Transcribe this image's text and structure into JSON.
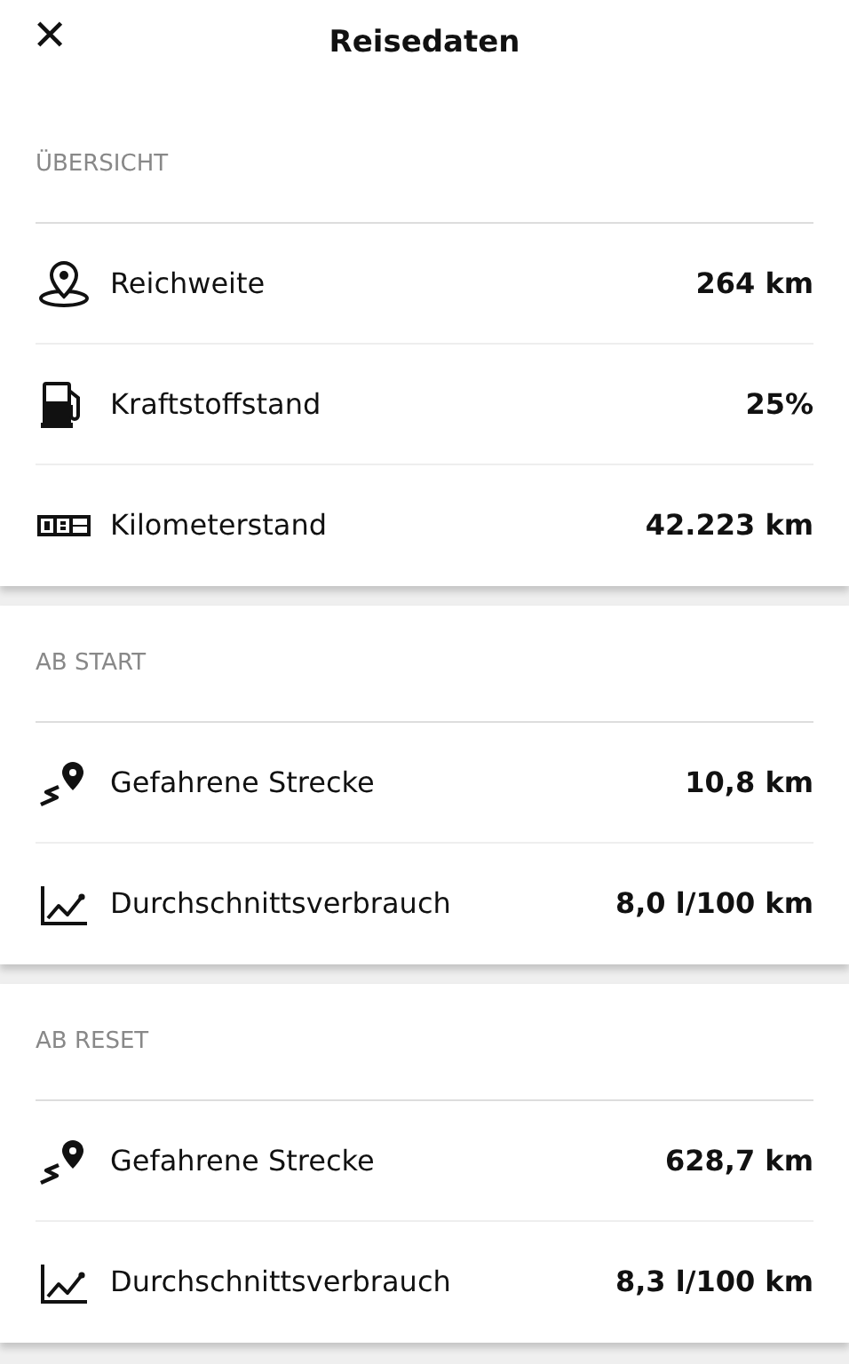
{
  "header": {
    "close": "✕",
    "title": "Reisedaten"
  },
  "sections": [
    {
      "heading": "ÜBERSICHT",
      "rows": [
        {
          "kind": "range",
          "label": "Reichweite",
          "value": "264 km"
        },
        {
          "kind": "fuel",
          "label": "Kraftstoffstand",
          "value": "25%"
        },
        {
          "kind": "odometer",
          "label": "Kilometerstand",
          "value": "42.223 km"
        }
      ]
    },
    {
      "heading": "AB START",
      "rows": [
        {
          "kind": "distance",
          "label": "Gefahrene Strecke",
          "value": "10,8 km"
        },
        {
          "kind": "consumption",
          "label": "Durchschnittsverbrauch",
          "value": "8,0 l/100 km"
        }
      ]
    },
    {
      "heading": "AB RESET",
      "rows": [
        {
          "kind": "distance",
          "label": "Gefahrene Strecke",
          "value": "628,7 km"
        },
        {
          "kind": "consumption",
          "label": "Durchschnittsverbrauch",
          "value": "8,3 l/100 km"
        }
      ]
    }
  ]
}
